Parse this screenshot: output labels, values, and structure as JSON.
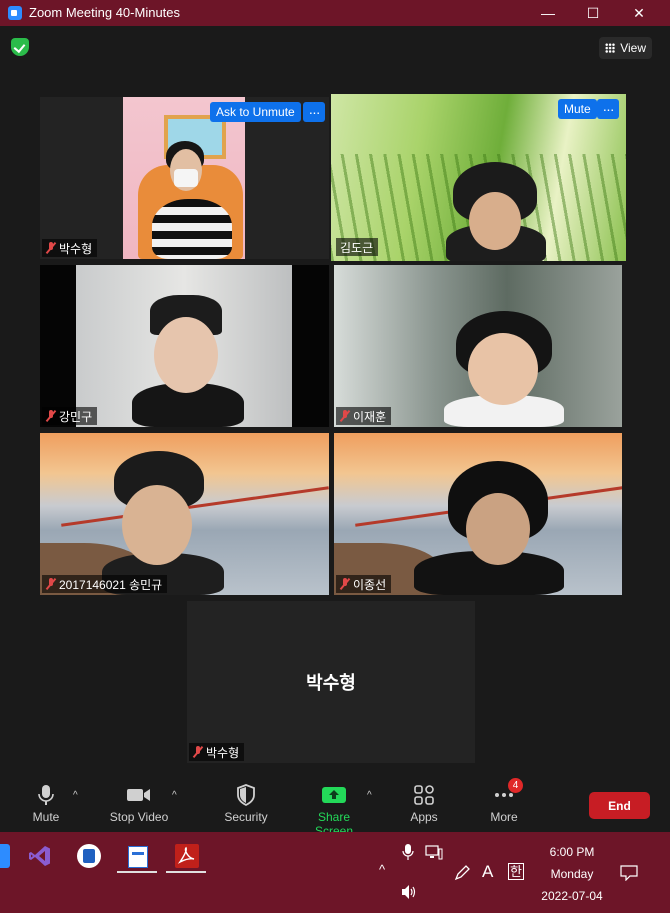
{
  "window": {
    "title": "Zoom Meeting 40-Minutes",
    "minimize": "—",
    "maximize": "☐",
    "close": "✕"
  },
  "view_button": {
    "label": "View"
  },
  "tiles": [
    {
      "name": "박수형",
      "overlay_button": "Ask to Unmute",
      "more": "···",
      "muted": true
    },
    {
      "name": "김도근",
      "overlay_button": "Mute",
      "more": "···",
      "muted": false,
      "active_speaker": true
    },
    {
      "name": "강민구",
      "muted": true
    },
    {
      "name": "이재훈",
      "muted": true
    },
    {
      "name": "2017146021 송민규",
      "muted": true
    },
    {
      "name": "이종선",
      "muted": true
    },
    {
      "name": "박수형",
      "center_name": "박수형",
      "muted": true,
      "video_off": true
    }
  ],
  "toolbar": {
    "mute": "Mute",
    "stop_video": "Stop Video",
    "security": "Security",
    "share_screen": "Share Screen",
    "apps": "Apps",
    "more": "More",
    "more_badge": "4",
    "end": "End",
    "caret": "^"
  },
  "taskbar": {
    "time": "6:00 PM",
    "day": "Monday",
    "date": "2022-07-04",
    "font_glyph": "A",
    "ime_glyph": "한",
    "chevron": "^",
    "colors": {
      "bar": "#6d1528",
      "vs": "#8a5cd0",
      "pdf": "#c0201a"
    }
  }
}
